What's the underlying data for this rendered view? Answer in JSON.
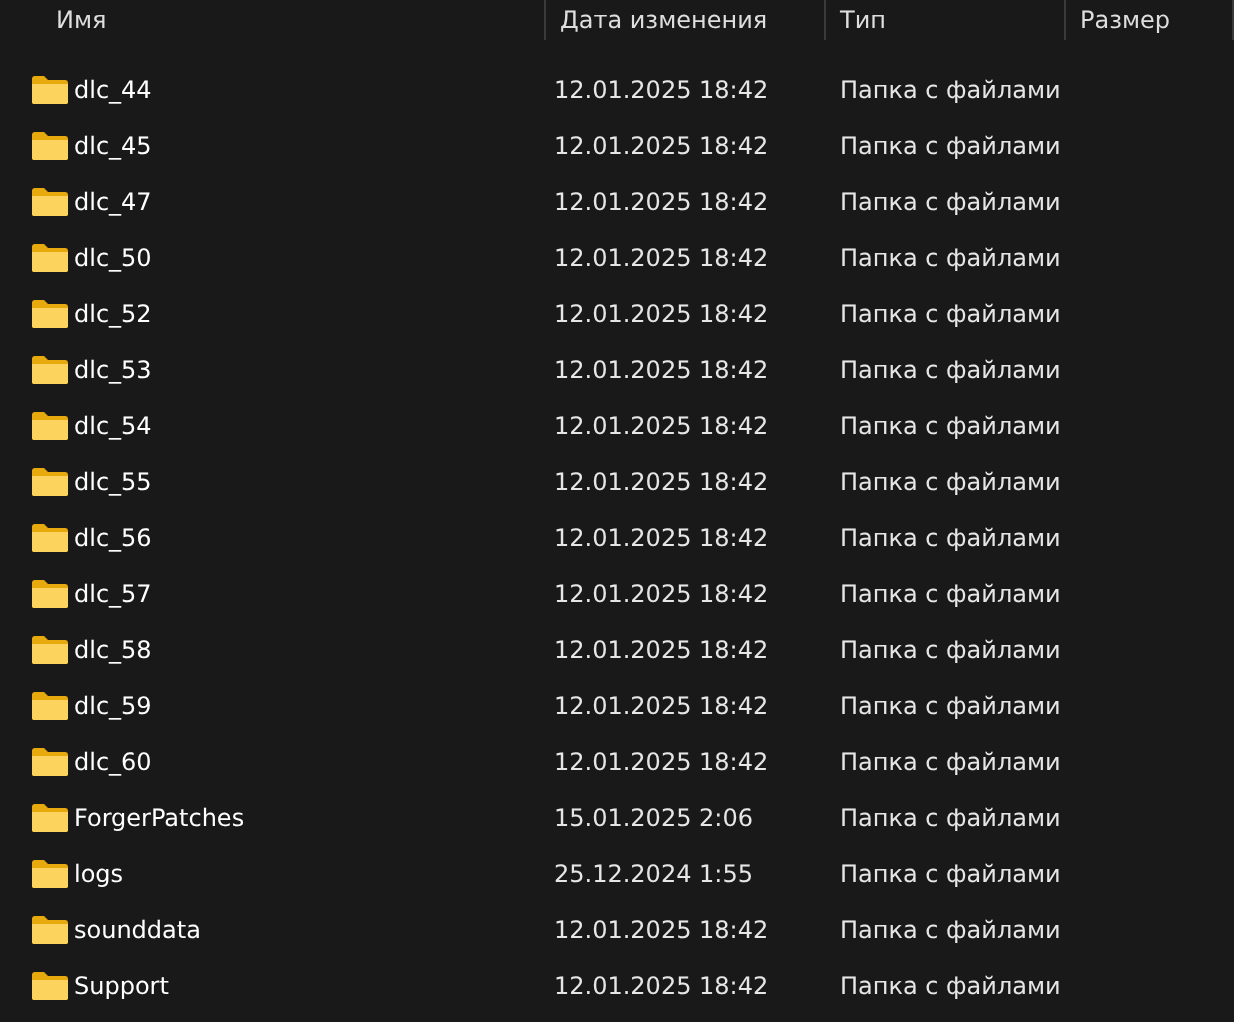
{
  "columns": [
    "Имя",
    "Дата изменения",
    "Тип",
    "Размер"
  ],
  "rows": [
    {
      "name": "dlc_44",
      "date": "12.01.2025 18:42",
      "type": "Папка с файлами"
    },
    {
      "name": "dlc_45",
      "date": "12.01.2025 18:42",
      "type": "Папка с файлами"
    },
    {
      "name": "dlc_47",
      "date": "12.01.2025 18:42",
      "type": "Папка с файлами"
    },
    {
      "name": "dlc_50",
      "date": "12.01.2025 18:42",
      "type": "Папка с файлами"
    },
    {
      "name": "dlc_52",
      "date": "12.01.2025 18:42",
      "type": "Папка с файлами"
    },
    {
      "name": "dlc_53",
      "date": "12.01.2025 18:42",
      "type": "Папка с файлами"
    },
    {
      "name": "dlc_54",
      "date": "12.01.2025 18:42",
      "type": "Папка с файлами"
    },
    {
      "name": "dlc_55",
      "date": "12.01.2025 18:42",
      "type": "Папка с файлами"
    },
    {
      "name": "dlc_56",
      "date": "12.01.2025 18:42",
      "type": "Папка с файлами"
    },
    {
      "name": "dlc_57",
      "date": "12.01.2025 18:42",
      "type": "Папка с файлами"
    },
    {
      "name": "dlc_58",
      "date": "12.01.2025 18:42",
      "type": "Папка с файлами"
    },
    {
      "name": "dlc_59",
      "date": "12.01.2025 18:42",
      "type": "Папка с файлами"
    },
    {
      "name": "dlc_60",
      "date": "12.01.2025 18:42",
      "type": "Папка с файлами"
    },
    {
      "name": "ForgerPatches",
      "date": "15.01.2025 2:06",
      "type": "Папка с файлами"
    },
    {
      "name": "logs",
      "date": "25.12.2024 1:55",
      "type": "Папка с файлами"
    },
    {
      "name": "sounddata",
      "date": "12.01.2025 18:42",
      "type": "Папка с файлами"
    },
    {
      "name": "Support",
      "date": "12.01.2025 18:42",
      "type": "Папка с файлами"
    }
  ]
}
